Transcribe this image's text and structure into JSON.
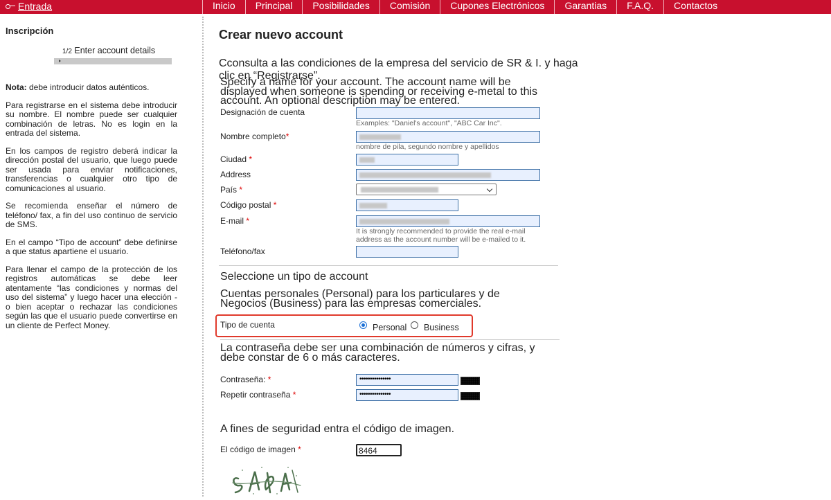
{
  "topbar": {
    "entrada": "Entrada",
    "nav": [
      "Inicio",
      "Principal",
      "Posibilidades",
      "Comisión",
      "Cupones Electrónicos",
      "Garantias",
      "F.A.Q.",
      "Contactos"
    ]
  },
  "sidebar": {
    "title": "Inscripción",
    "step_fraction": "1/2",
    "step_label": "Enter account details",
    "nota_bold": "Nota:",
    "nota_text": " debe introducir datos auténticos.",
    "p1": "Para registrarse en el sistema debe introducir su nombre. El nombre puede ser cualquier combinación de letras. No es login en la entrada del sistema.",
    "p2": "En los campos de registro deberá indicar la dirección postal del usuario, que luego puede ser usada para enviar notificaciones, transferencias o cualquier otro tipo de comunicaciones al usuario.",
    "p3": "Se recomienda enseñar el número de teléfono/ fax, a fin del uso continuo de servicio de SMS.",
    "p4": "En el campo “Tipo de account” debe definirse a que status apartiene el usuario.",
    "p5": "Para llenar el campo de la protección de los registros automáticas se debe leer atentamente “las condiciones y normas del uso del sistema” y luego hacer una elección - o bien aceptar o rechazar las condiciones según las que el usuario puede convertirse en un cliente de Perfect Money."
  },
  "main": {
    "title": "Crear nuevo account",
    "intro": "Cconsulta a las condiciones de la empresa del servicio de SR & I. y haga clic en “Registrarse”.",
    "specify": "Specify a name for your account. The account name will be displayed when someone is spending or receiving e-metal to this account. An optional description may be entered.",
    "fields": {
      "designacion": "Designación de cuenta",
      "designacion_hint": "Examples: \"Daniel's account\", \"ABC Car Inc\".",
      "nombre": "Nombre completo",
      "nombre_hint": "nombre de pila, segundo nombre y apellidos",
      "ciudad": "Ciudad ",
      "address": "Address",
      "pais": "País ",
      "codigo_postal": "Código postal ",
      "email": "E-mail ",
      "email_hint": "It is strongly recommended to provide the real e-mail address as the account number will be e-mailed to it.",
      "telefono": "Teléfono/fax"
    },
    "required_mark": "*",
    "tipo_heading": "Seleccione un tipo de account",
    "tipo_desc": "Cuentas personales (Personal) para los particulares y de Negocios (Business) para las empresas comerciales.",
    "tipo_label": "Tipo de cuenta",
    "tipo_personal": "Personal",
    "tipo_business": "Business",
    "password_desc": "La contraseña debe ser una combinación de números y cifras, y debe constar de 6 o más caracteres.",
    "password_label": "Contraseña: ",
    "password_repeat_label": "Repetir contraseña ",
    "password_mask": "•••••••••••••••",
    "security_desc": "A fines de seguridad entra el código de imagen.",
    "captcha_label": "El código de imagen ",
    "captcha_value": "8464"
  }
}
